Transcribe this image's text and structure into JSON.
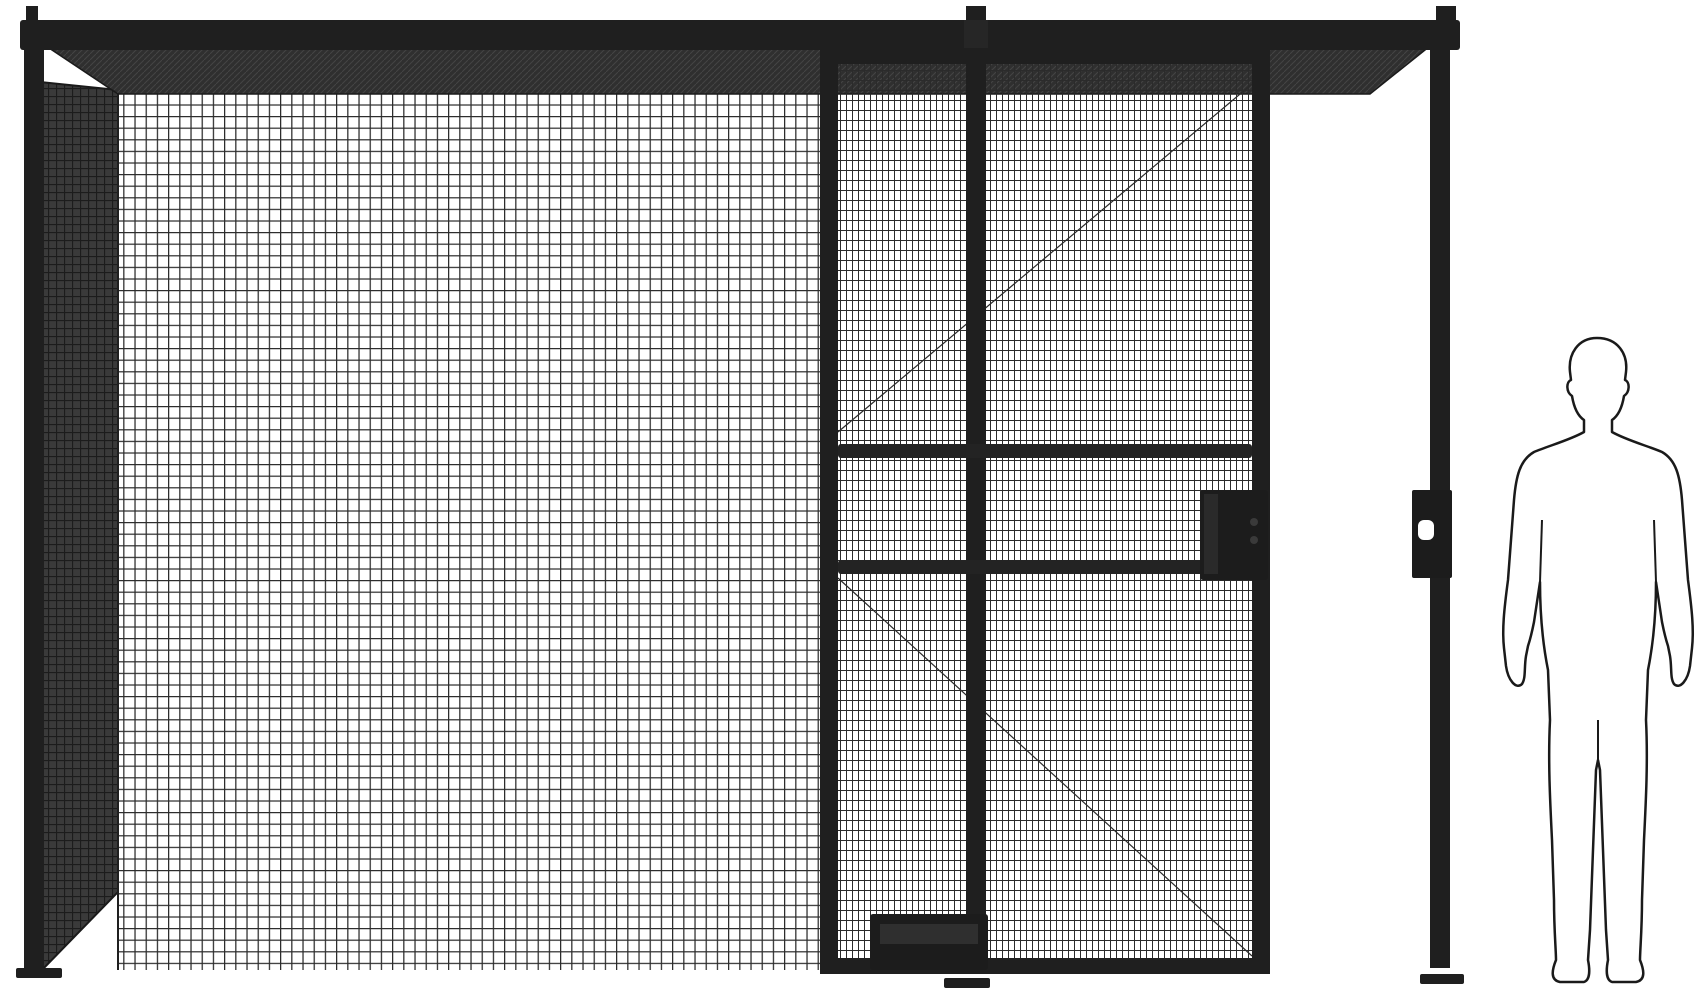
{
  "figure": {
    "subject": "wire-mesh-partition-with-sliding-door",
    "scale_reference": "human-silhouette",
    "colors": {
      "background": "#ffffff",
      "frame": "#1f1f1f",
      "mesh": "#2a2a2a",
      "side_panel": "#262626",
      "silhouette_stroke": "#1a1a1a",
      "silhouette_fill": "#ffffff"
    },
    "icons": {
      "lock": "door-lock-box",
      "strike": "post-strike-plate",
      "foot": "floor-base-plate",
      "person": "person-silhouette-icon"
    }
  }
}
